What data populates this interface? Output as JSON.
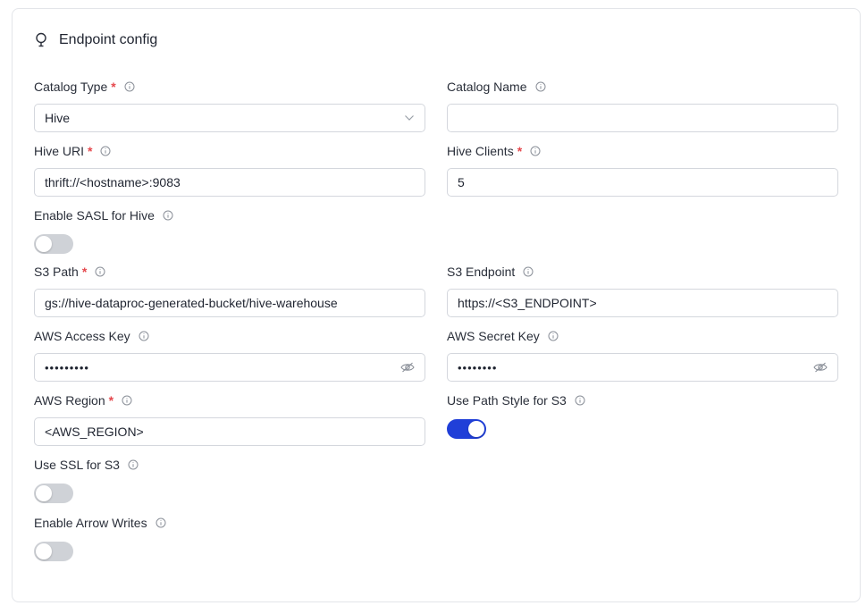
{
  "header": {
    "title": "Endpoint config",
    "icon": "lightbulb-icon"
  },
  "accent_color": "#203fd8",
  "required_color": "#e5484d",
  "fields": {
    "catalog_type": {
      "label": "Catalog Type",
      "required": "*",
      "value": "Hive"
    },
    "catalog_name": {
      "label": "Catalog Name",
      "value": ""
    },
    "hive_uri": {
      "label": "Hive URI",
      "required": "*",
      "value": "thrift://<hostname>:9083"
    },
    "hive_clients": {
      "label": "Hive Clients",
      "required": "*",
      "value": "5"
    },
    "enable_sasl": {
      "label": "Enable SASL for Hive",
      "state": "off"
    },
    "s3_path": {
      "label": "S3 Path",
      "required": "*",
      "value": "gs://hive-dataproc-generated-bucket/hive-warehouse"
    },
    "s3_endpoint": {
      "label": "S3 Endpoint",
      "value": "https://<S3_ENDPOINT>"
    },
    "aws_access_key": {
      "label": "AWS Access Key",
      "value": "•••••••••"
    },
    "aws_secret_key": {
      "label": "AWS Secret Key",
      "value": "••••••••"
    },
    "aws_region": {
      "label": "AWS Region",
      "required": "*",
      "value": "<AWS_REGION>"
    },
    "use_path_style": {
      "label": "Use Path Style for S3",
      "state": "on"
    },
    "use_ssl": {
      "label": "Use SSL for S3",
      "state": "off"
    },
    "enable_arrow_writes": {
      "label": "Enable Arrow Writes",
      "state": "off"
    }
  }
}
